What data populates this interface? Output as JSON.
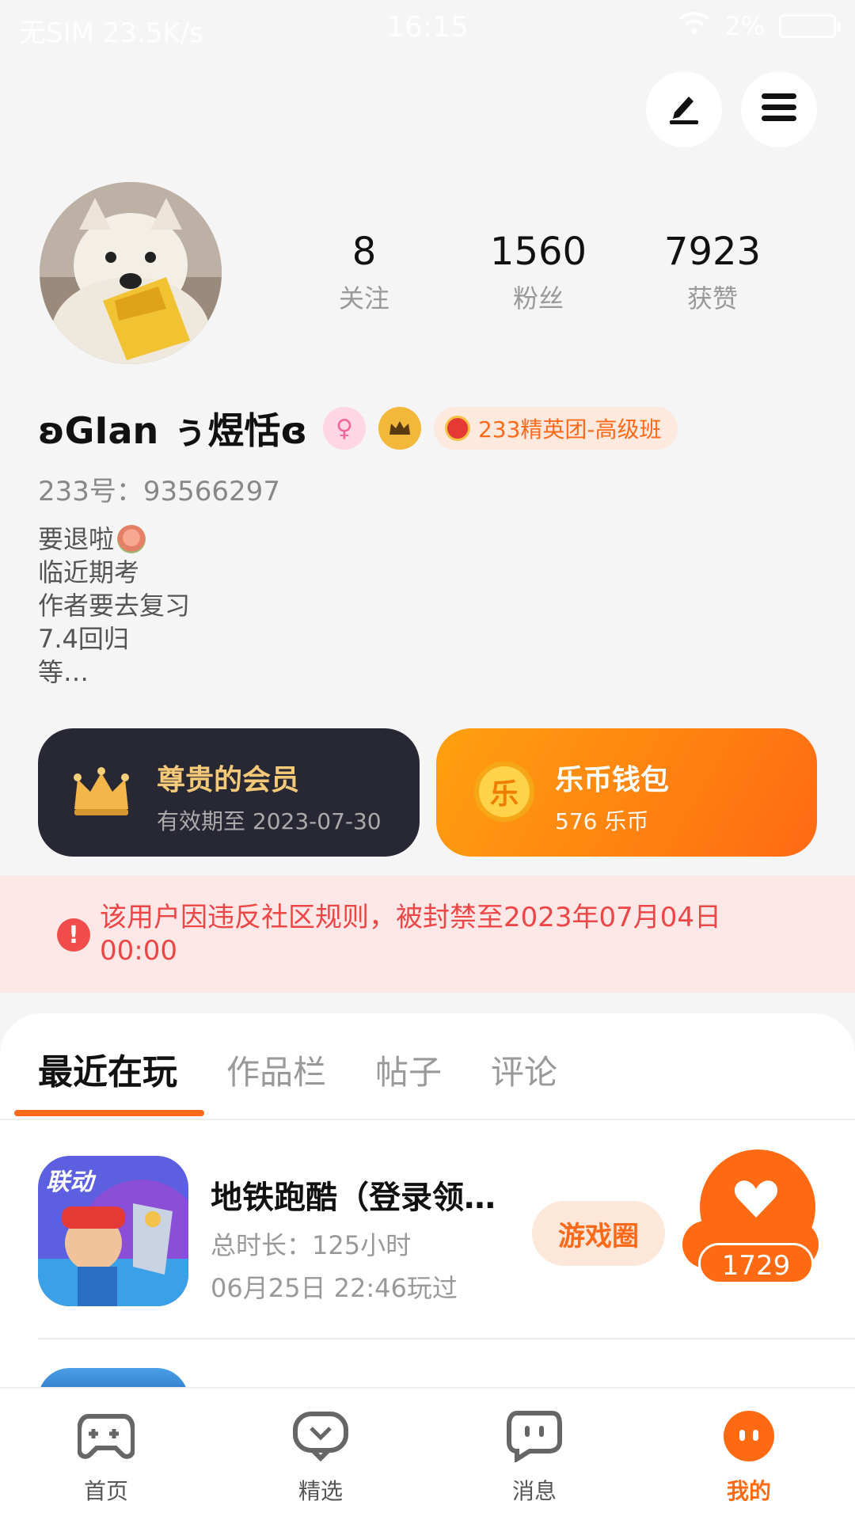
{
  "status_bar": {
    "left": "无SIM 23.5K/s",
    "time": "16:15",
    "battery": "2%"
  },
  "profile": {
    "username": "ʚGIan ぅ煜恬ɞ",
    "gender_symbol": "♀",
    "group_tag": "233精英团-高级班",
    "id_line": "233号：93566297",
    "bio": [
      "要退啦",
      "临近期考",
      "作者要去复习",
      "7.4回归",
      "等…"
    ],
    "stats": [
      {
        "value": "8",
        "label": "关注"
      },
      {
        "value": "1560",
        "label": "粉丝"
      },
      {
        "value": "7923",
        "label": "获赞"
      }
    ]
  },
  "vip_card": {
    "title": "尊贵的会员",
    "subtitle": "有效期至 2023-07-30"
  },
  "coin_card": {
    "icon_text": "乐",
    "title": "乐币钱包",
    "subtitle": "576 乐币"
  },
  "ban_notice": {
    "icon": "!",
    "text": "该用户因违反社区规则，被封禁至2023年07月04日 00:00"
  },
  "tabs": [
    {
      "label": "最近在玩",
      "active": true
    },
    {
      "label": "作品栏",
      "active": false
    },
    {
      "label": "帖子",
      "active": false
    },
    {
      "label": "评论",
      "active": false
    }
  ],
  "games": [
    {
      "title": "地铁跑酷（登录领…",
      "duration": "总时长：125小时",
      "last_played": "06月25日 22:46玩过",
      "circle_button": "游戏圈",
      "likes": "1729",
      "icon_badge": "联动"
    }
  ],
  "bottom_nav": [
    {
      "label": "首页",
      "icon": "gamepad-icon"
    },
    {
      "label": "精选",
      "icon": "heart-chat-icon"
    },
    {
      "label": "消息",
      "icon": "message-icon"
    },
    {
      "label": "我的",
      "icon": "profile-face-icon",
      "active": true
    }
  ],
  "colors": {
    "accent": "#ff6a12",
    "vip_gold": "#f5c977",
    "ban_red": "#ec4646",
    "dark_card": "#272834"
  }
}
